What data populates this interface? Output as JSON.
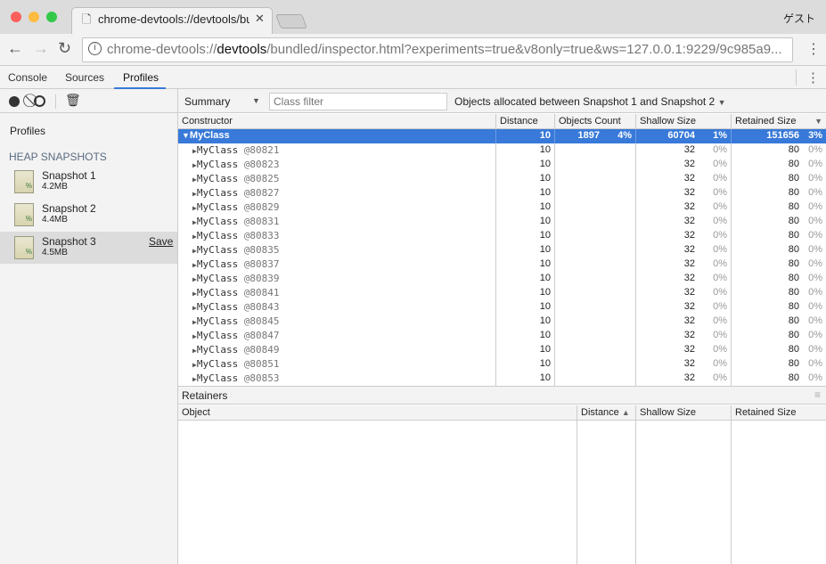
{
  "browser": {
    "tab_title": "chrome-devtools://devtools/bundled/inspector.html",
    "profile": "ゲスト",
    "url_prefix": "chrome-devtools://",
    "url_host": "devtools",
    "url_rest": "/bundled/inspector.html?experiments=true&v8only=true&ws=127.0.0.1:9229/9c985a9..."
  },
  "devtools": {
    "tabs": [
      "Console",
      "Sources",
      "Profiles"
    ],
    "active_tab": "Profiles"
  },
  "sidebar": {
    "title": "Profiles",
    "section": "HEAP SNAPSHOTS",
    "save_label": "Save",
    "snapshots": [
      {
        "name": "Snapshot 1",
        "size": "4.2MB"
      },
      {
        "name": "Snapshot 2",
        "size": "4.4MB"
      },
      {
        "name": "Snapshot 3",
        "size": "4.5MB"
      }
    ]
  },
  "filter": {
    "view": "Summary",
    "class_filter_placeholder": "Class filter",
    "range": "Objects allocated between Snapshot 1 and Snapshot 2"
  },
  "table": {
    "headers": [
      "Constructor",
      "Distance",
      "Objects Count",
      "Shallow Size",
      "Retained Size"
    ],
    "group": {
      "name": "MyClass",
      "distance": "10",
      "count": "1897",
      "count_pct": "4%",
      "shallow": "60704",
      "shallow_pct": "1%",
      "retained": "151656",
      "retained_pct": "3%"
    },
    "rows": [
      {
        "name": "MyClass",
        "id": "@80821",
        "distance": "10",
        "shallow": "32",
        "shallow_pct": "0%",
        "retained": "80",
        "retained_pct": "0%"
      },
      {
        "name": "MyClass",
        "id": "@80823",
        "distance": "10",
        "shallow": "32",
        "shallow_pct": "0%",
        "retained": "80",
        "retained_pct": "0%"
      },
      {
        "name": "MyClass",
        "id": "@80825",
        "distance": "10",
        "shallow": "32",
        "shallow_pct": "0%",
        "retained": "80",
        "retained_pct": "0%"
      },
      {
        "name": "MyClass",
        "id": "@80827",
        "distance": "10",
        "shallow": "32",
        "shallow_pct": "0%",
        "retained": "80",
        "retained_pct": "0%"
      },
      {
        "name": "MyClass",
        "id": "@80829",
        "distance": "10",
        "shallow": "32",
        "shallow_pct": "0%",
        "retained": "80",
        "retained_pct": "0%"
      },
      {
        "name": "MyClass",
        "id": "@80831",
        "distance": "10",
        "shallow": "32",
        "shallow_pct": "0%",
        "retained": "80",
        "retained_pct": "0%"
      },
      {
        "name": "MyClass",
        "id": "@80833",
        "distance": "10",
        "shallow": "32",
        "shallow_pct": "0%",
        "retained": "80",
        "retained_pct": "0%"
      },
      {
        "name": "MyClass",
        "id": "@80835",
        "distance": "10",
        "shallow": "32",
        "shallow_pct": "0%",
        "retained": "80",
        "retained_pct": "0%"
      },
      {
        "name": "MyClass",
        "id": "@80837",
        "distance": "10",
        "shallow": "32",
        "shallow_pct": "0%",
        "retained": "80",
        "retained_pct": "0%"
      },
      {
        "name": "MyClass",
        "id": "@80839",
        "distance": "10",
        "shallow": "32",
        "shallow_pct": "0%",
        "retained": "80",
        "retained_pct": "0%"
      },
      {
        "name": "MyClass",
        "id": "@80841",
        "distance": "10",
        "shallow": "32",
        "shallow_pct": "0%",
        "retained": "80",
        "retained_pct": "0%"
      },
      {
        "name": "MyClass",
        "id": "@80843",
        "distance": "10",
        "shallow": "32",
        "shallow_pct": "0%",
        "retained": "80",
        "retained_pct": "0%"
      },
      {
        "name": "MyClass",
        "id": "@80845",
        "distance": "10",
        "shallow": "32",
        "shallow_pct": "0%",
        "retained": "80",
        "retained_pct": "0%"
      },
      {
        "name": "MyClass",
        "id": "@80847",
        "distance": "10",
        "shallow": "32",
        "shallow_pct": "0%",
        "retained": "80",
        "retained_pct": "0%"
      },
      {
        "name": "MyClass",
        "id": "@80849",
        "distance": "10",
        "shallow": "32",
        "shallow_pct": "0%",
        "retained": "80",
        "retained_pct": "0%"
      },
      {
        "name": "MyClass",
        "id": "@80851",
        "distance": "10",
        "shallow": "32",
        "shallow_pct": "0%",
        "retained": "80",
        "retained_pct": "0%"
      },
      {
        "name": "MyClass",
        "id": "@80853",
        "distance": "10",
        "shallow": "32",
        "shallow_pct": "0%",
        "retained": "80",
        "retained_pct": "0%"
      }
    ]
  },
  "retainers": {
    "title": "Retainers",
    "headers": [
      "Object",
      "Distance",
      "Shallow Size",
      "Retained Size"
    ]
  },
  "colors": {
    "accent": "#3879d9",
    "close": "#fc605c",
    "minimize": "#fdbc40",
    "maximize": "#34c84a"
  }
}
